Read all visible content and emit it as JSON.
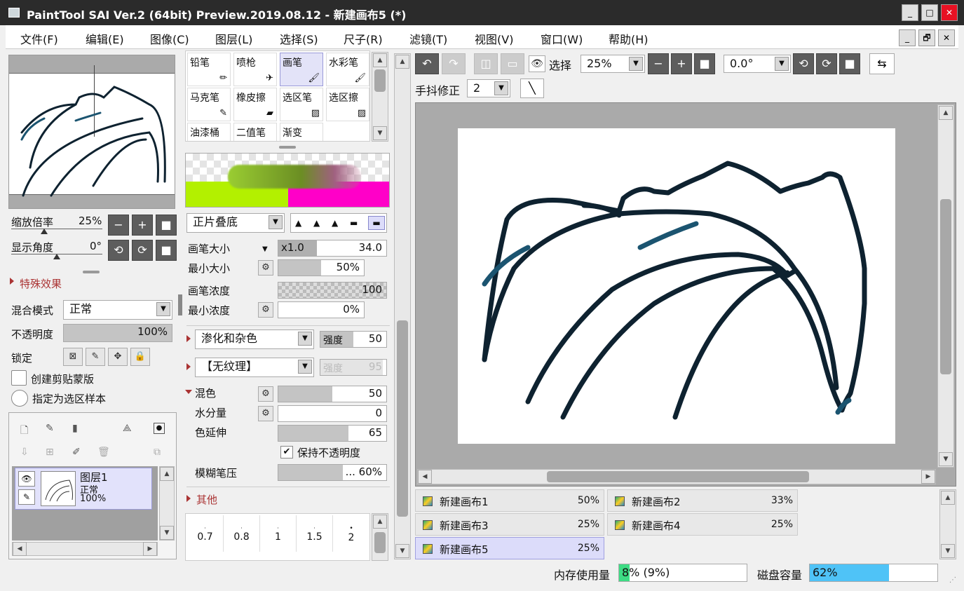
{
  "window": {
    "title": "PaintTool SAI Ver.2 (64bit) Preview.2019.08.12 - 新建画布5 (*)",
    "min": "_",
    "max": "□",
    "close": "✕"
  },
  "menu": [
    "文件(F)",
    "编辑(E)",
    "图像(C)",
    "图层(L)",
    "选择(S)",
    "尺子(R)",
    "滤镜(T)",
    "视图(V)",
    "窗口(W)",
    "帮助(H)"
  ],
  "mdi": {
    "min": "_",
    "restore": "🗗",
    "close": "✕"
  },
  "navigator": {
    "zoom_label": "缩放倍率",
    "zoom_value": "25%",
    "angle_label": "显示角度",
    "angle_value": "0°"
  },
  "layer_props": {
    "effects_label": "特殊效果",
    "blend_label": "混合模式",
    "blend_value": "正常",
    "opacity_label": "不透明度",
    "opacity_value": "100%",
    "opacity": 1.0,
    "lock_label": "锁定",
    "clip_label": "创建剪贴蒙版",
    "sample_label": "指定为选区样本"
  },
  "layer": {
    "name": "图层1",
    "mode": "正常",
    "opacity": "100%"
  },
  "tools": [
    "铅笔",
    "喷枪",
    "画笔",
    "水彩笔",
    "马克笔",
    "橡皮擦",
    "选区笔",
    "选区擦",
    "油漆桶",
    "二值笔",
    "渐变"
  ],
  "brush": {
    "blend_value": "正片叠底",
    "size_label": "画笔大小",
    "size_mult": "x1.0",
    "size_value": "34.0",
    "min_size_label": "最小大小",
    "min_size_value": "50%",
    "min_size": 0.5,
    "density_label": "画笔浓度",
    "density_value": "100",
    "min_density_label": "最小浓度",
    "min_density_value": "0%",
    "texture1": "渗化和杂色",
    "strength_label": "强度",
    "strength1": "50",
    "texture2": "【无纹理】",
    "strength2": "95",
    "mix_label": "混色",
    "mix_value": "50",
    "mix": 0.5,
    "water_label": "水分量",
    "water_value": "0",
    "stretch_label": "色延伸",
    "stretch_value": "65",
    "stretch": 0.65,
    "keep_opacity": "保持不透明度",
    "blur_label": "模糊笔压",
    "blur_value": "... 60%",
    "blur": 0.6,
    "other_label": "其他"
  },
  "brush_sizes": [
    "0.7",
    "0.8",
    "1",
    "1.5",
    "2"
  ],
  "canvas_toolbar": {
    "select_label": "选择",
    "zoom": "25%",
    "angle": "0.0°",
    "stab_label": "手抖修正",
    "stab_value": "2"
  },
  "tabs": [
    {
      "name": "新建画布1",
      "pct": "50%"
    },
    {
      "name": "新建画布2",
      "pct": "33%"
    },
    {
      "name": "新建画布3",
      "pct": "25%"
    },
    {
      "name": "新建画布4",
      "pct": "25%"
    },
    {
      "name": "新建画布5",
      "pct": "25%"
    }
  ],
  "status": {
    "mem_label": "内存使用量",
    "mem_value": "8% (9%)",
    "mem": 0.08,
    "disk_label": "磁盘容量",
    "disk_value": "62%",
    "disk": 0.62
  },
  "colors": {
    "accent_cyan": "#4fc3f7",
    "mem_green": "#3ddc84",
    "stroke": "#0e2230"
  }
}
